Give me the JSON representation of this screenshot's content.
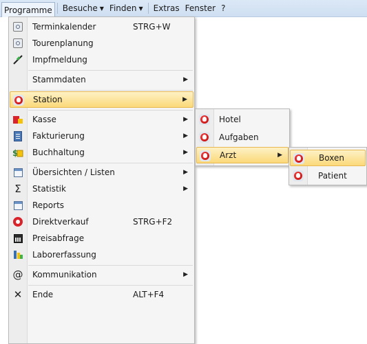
{
  "menubar": {
    "items": [
      "Programme",
      "Besuche",
      "Finden",
      "Extras",
      "Fenster",
      "?"
    ]
  },
  "main_menu": {
    "items": [
      {
        "label": "Terminkalender",
        "shortcut": "STRG+W",
        "icon": "calendar-icon",
        "submenu": false
      },
      {
        "label": "Tourenplanung",
        "shortcut": "",
        "icon": "calendar-icon",
        "submenu": false
      },
      {
        "label": "Impfmeldung",
        "shortcut": "",
        "icon": "syringe-icon",
        "submenu": false
      },
      {
        "label": "Stammdaten",
        "shortcut": "",
        "icon": "",
        "submenu": true
      },
      {
        "label": "Station",
        "shortcut": "",
        "icon": "paw-icon",
        "submenu": true,
        "highlighted": true
      },
      {
        "label": "Kasse",
        "shortcut": "",
        "icon": "cash-icon",
        "submenu": true
      },
      {
        "label": "Fakturierung",
        "shortcut": "",
        "icon": "invoice-icon",
        "submenu": true
      },
      {
        "label": "Buchhaltung",
        "shortcut": "",
        "icon": "money-icon",
        "submenu": true
      },
      {
        "label": "Übersichten / Listen",
        "shortcut": "",
        "icon": "list-icon",
        "submenu": true
      },
      {
        "label": "Statistik",
        "shortcut": "",
        "icon": "sigma-icon",
        "submenu": true
      },
      {
        "label": "Reports",
        "shortcut": "",
        "icon": "report-icon",
        "submenu": false
      },
      {
        "label": "Direktverkauf",
        "shortcut": "STRG+F2",
        "icon": "sale-icon",
        "submenu": false
      },
      {
        "label": "Preisabfrage",
        "shortcut": "",
        "icon": "calculator-icon",
        "submenu": false
      },
      {
        "label": "Laborerfassung",
        "shortcut": "",
        "icon": "lab-icon",
        "submenu": false
      },
      {
        "label": "Kommunikation",
        "shortcut": "",
        "icon": "at-icon",
        "submenu": true
      },
      {
        "label": "Ende",
        "shortcut": "ALT+F4",
        "icon": "close-icon",
        "submenu": false
      }
    ]
  },
  "station_menu": {
    "items": [
      {
        "label": "Hotel",
        "icon": "paw-icon",
        "submenu": false
      },
      {
        "label": "Aufgaben",
        "icon": "paw-icon",
        "submenu": false
      },
      {
        "label": "Arzt",
        "icon": "paw-icon",
        "submenu": true,
        "highlighted": true
      }
    ]
  },
  "arzt_menu": {
    "items": [
      {
        "label": "Boxen",
        "icon": "paw-icon",
        "highlighted": true
      },
      {
        "label": "Patient",
        "icon": "paw-icon"
      }
    ]
  },
  "colors": {
    "highlight": "#fbd97a",
    "menubar": "#d3e2f3"
  }
}
